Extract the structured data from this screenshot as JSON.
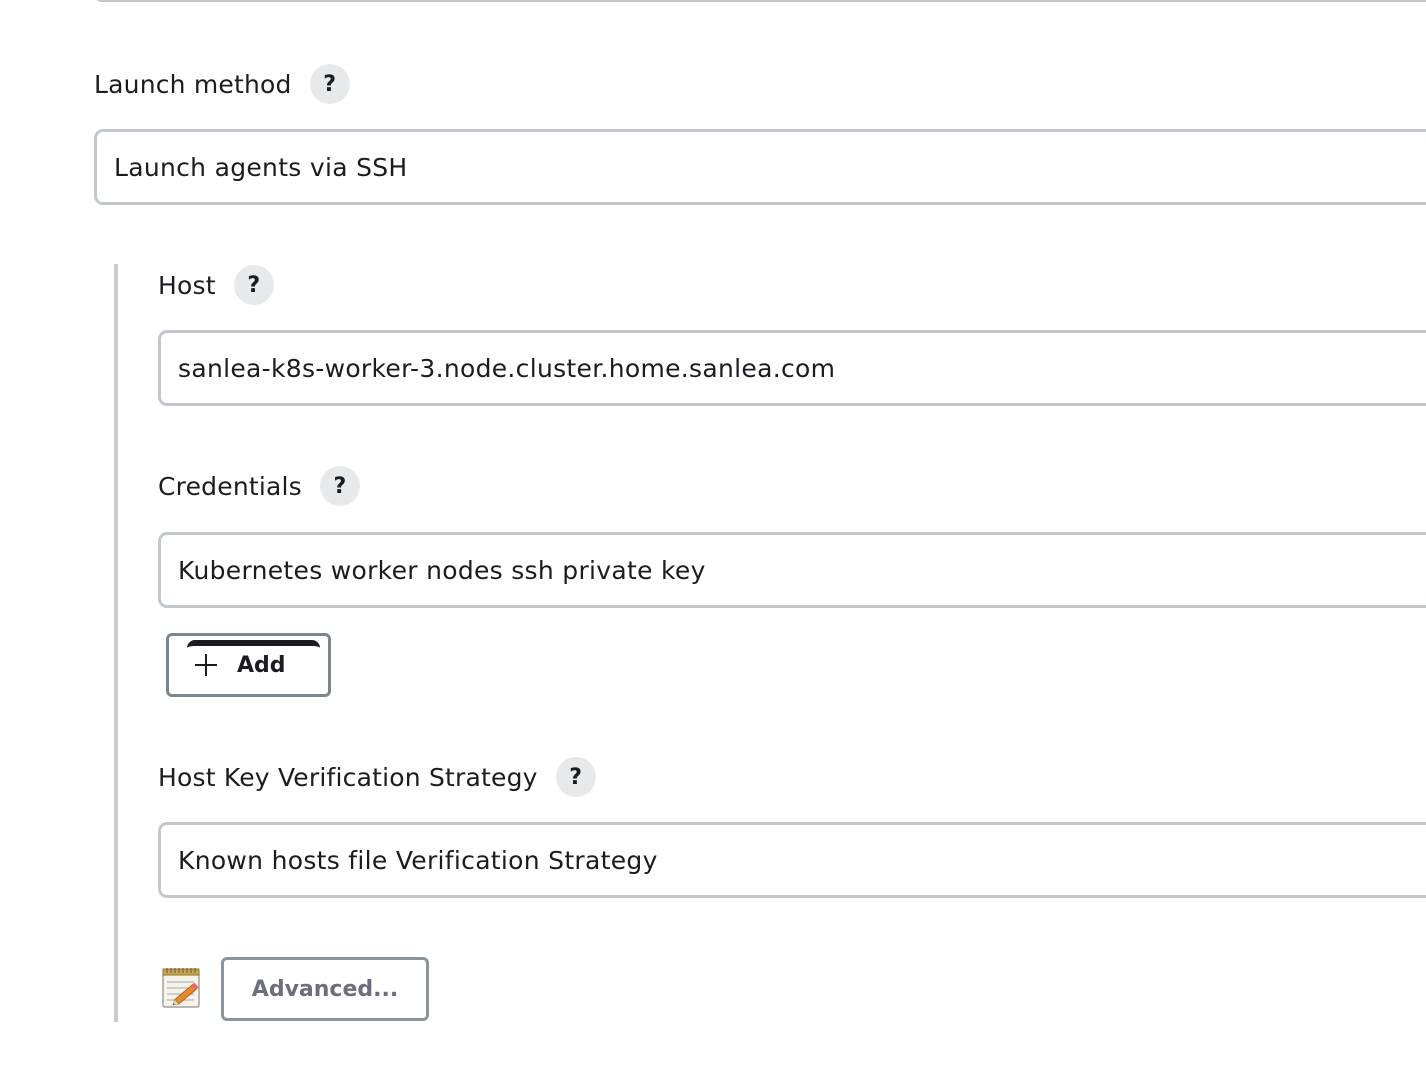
{
  "launch_method": {
    "label": "Launch method",
    "help": "?",
    "value": "Launch agents via SSH"
  },
  "host": {
    "label": "Host",
    "help": "?",
    "value": "sanlea-k8s-worker-3.node.cluster.home.sanlea.com"
  },
  "credentials": {
    "label": "Credentials",
    "help": "?",
    "value": "Kubernetes worker nodes ssh private key",
    "add_label": "Add"
  },
  "host_key_strategy": {
    "label": "Host Key Verification Strategy",
    "help": "?",
    "value": "Known hosts file Verification Strategy"
  },
  "advanced": {
    "label": "Advanced..."
  },
  "icons": {
    "help": "help-icon",
    "plus": "plus-icon",
    "notepad": "notepad-icon"
  }
}
